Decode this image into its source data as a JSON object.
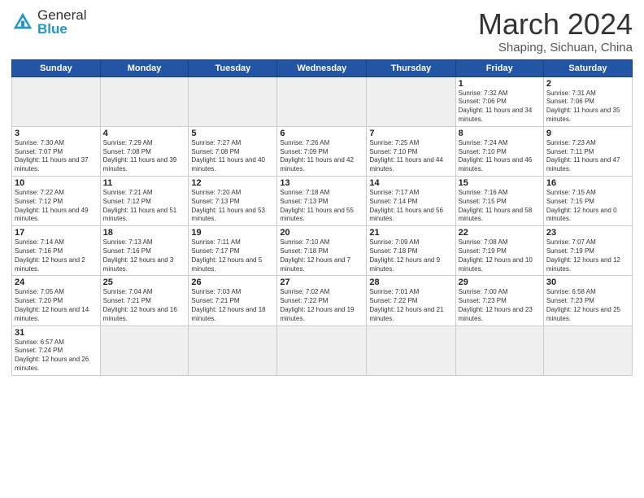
{
  "logo": {
    "general": "General",
    "blue": "Blue"
  },
  "title": {
    "month_year": "March 2024",
    "location": "Shaping, Sichuan, China"
  },
  "weekdays": [
    "Sunday",
    "Monday",
    "Tuesday",
    "Wednesday",
    "Thursday",
    "Friday",
    "Saturday"
  ],
  "days": [
    {
      "num": "",
      "info": ""
    },
    {
      "num": "",
      "info": ""
    },
    {
      "num": "",
      "info": ""
    },
    {
      "num": "",
      "info": ""
    },
    {
      "num": "",
      "info": ""
    },
    {
      "num": "1",
      "info": "Sunrise: 7:32 AM\nSunset: 7:06 PM\nDaylight: 11 hours and 34 minutes."
    },
    {
      "num": "2",
      "info": "Sunrise: 7:31 AM\nSunset: 7:06 PM\nDaylight: 11 hours and 35 minutes."
    },
    {
      "num": "3",
      "info": "Sunrise: 7:30 AM\nSunset: 7:07 PM\nDaylight: 11 hours and 37 minutes."
    },
    {
      "num": "4",
      "info": "Sunrise: 7:29 AM\nSunset: 7:08 PM\nDaylight: 11 hours and 39 minutes."
    },
    {
      "num": "5",
      "info": "Sunrise: 7:27 AM\nSunset: 7:08 PM\nDaylight: 11 hours and 40 minutes."
    },
    {
      "num": "6",
      "info": "Sunrise: 7:26 AM\nSunset: 7:09 PM\nDaylight: 11 hours and 42 minutes."
    },
    {
      "num": "7",
      "info": "Sunrise: 7:25 AM\nSunset: 7:10 PM\nDaylight: 11 hours and 44 minutes."
    },
    {
      "num": "8",
      "info": "Sunrise: 7:24 AM\nSunset: 7:10 PM\nDaylight: 11 hours and 46 minutes."
    },
    {
      "num": "9",
      "info": "Sunrise: 7:23 AM\nSunset: 7:11 PM\nDaylight: 11 hours and 47 minutes."
    },
    {
      "num": "10",
      "info": "Sunrise: 7:22 AM\nSunset: 7:12 PM\nDaylight: 11 hours and 49 minutes."
    },
    {
      "num": "11",
      "info": "Sunrise: 7:21 AM\nSunset: 7:12 PM\nDaylight: 11 hours and 51 minutes."
    },
    {
      "num": "12",
      "info": "Sunrise: 7:20 AM\nSunset: 7:13 PM\nDaylight: 11 hours and 53 minutes."
    },
    {
      "num": "13",
      "info": "Sunrise: 7:18 AM\nSunset: 7:13 PM\nDaylight: 11 hours and 55 minutes."
    },
    {
      "num": "14",
      "info": "Sunrise: 7:17 AM\nSunset: 7:14 PM\nDaylight: 11 hours and 56 minutes."
    },
    {
      "num": "15",
      "info": "Sunrise: 7:16 AM\nSunset: 7:15 PM\nDaylight: 11 hours and 58 minutes."
    },
    {
      "num": "16",
      "info": "Sunrise: 7:15 AM\nSunset: 7:15 PM\nDaylight: 12 hours and 0 minutes."
    },
    {
      "num": "17",
      "info": "Sunrise: 7:14 AM\nSunset: 7:16 PM\nDaylight: 12 hours and 2 minutes."
    },
    {
      "num": "18",
      "info": "Sunrise: 7:13 AM\nSunset: 7:16 PM\nDaylight: 12 hours and 3 minutes."
    },
    {
      "num": "19",
      "info": "Sunrise: 7:11 AM\nSunset: 7:17 PM\nDaylight: 12 hours and 5 minutes."
    },
    {
      "num": "20",
      "info": "Sunrise: 7:10 AM\nSunset: 7:18 PM\nDaylight: 12 hours and 7 minutes."
    },
    {
      "num": "21",
      "info": "Sunrise: 7:09 AM\nSunset: 7:18 PM\nDaylight: 12 hours and 9 minutes."
    },
    {
      "num": "22",
      "info": "Sunrise: 7:08 AM\nSunset: 7:19 PM\nDaylight: 12 hours and 10 minutes."
    },
    {
      "num": "23",
      "info": "Sunrise: 7:07 AM\nSunset: 7:19 PM\nDaylight: 12 hours and 12 minutes."
    },
    {
      "num": "24",
      "info": "Sunrise: 7:05 AM\nSunset: 7:20 PM\nDaylight: 12 hours and 14 minutes."
    },
    {
      "num": "25",
      "info": "Sunrise: 7:04 AM\nSunset: 7:21 PM\nDaylight: 12 hours and 16 minutes."
    },
    {
      "num": "26",
      "info": "Sunrise: 7:03 AM\nSunset: 7:21 PM\nDaylight: 12 hours and 18 minutes."
    },
    {
      "num": "27",
      "info": "Sunrise: 7:02 AM\nSunset: 7:22 PM\nDaylight: 12 hours and 19 minutes."
    },
    {
      "num": "28",
      "info": "Sunrise: 7:01 AM\nSunset: 7:22 PM\nDaylight: 12 hours and 21 minutes."
    },
    {
      "num": "29",
      "info": "Sunrise: 7:00 AM\nSunset: 7:23 PM\nDaylight: 12 hours and 23 minutes."
    },
    {
      "num": "30",
      "info": "Sunrise: 6:58 AM\nSunset: 7:23 PM\nDaylight: 12 hours and 25 minutes."
    },
    {
      "num": "31",
      "info": "Sunrise: 6:57 AM\nSunset: 7:24 PM\nDaylight: 12 hours and 26 minutes."
    },
    {
      "num": "",
      "info": ""
    },
    {
      "num": "",
      "info": ""
    },
    {
      "num": "",
      "info": ""
    },
    {
      "num": "",
      "info": ""
    },
    {
      "num": "",
      "info": ""
    },
    {
      "num": "",
      "info": ""
    }
  ]
}
